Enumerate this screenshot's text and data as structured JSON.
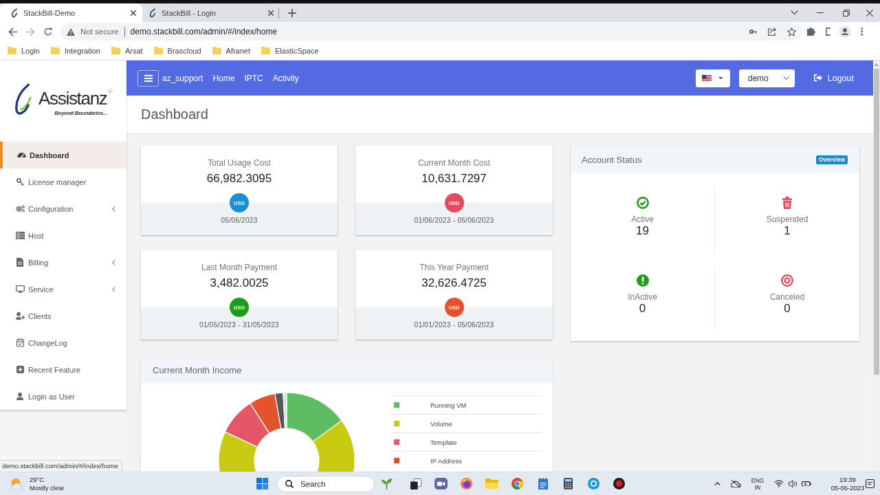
{
  "browser": {
    "tabs": [
      {
        "title": "StackBill-Demo",
        "selected": true
      },
      {
        "title": "StackBill - Login",
        "selected": false
      }
    ],
    "security_label": "Not secure",
    "url": "demo.stackbill.com/admin/#/index/home",
    "bookmarks": [
      "Login",
      "Integration",
      "Arsat",
      "Brascloud",
      "Afranet",
      "ElasticSpace"
    ]
  },
  "sidebar": {
    "logo": {
      "name": "Assistanz",
      "tagline": "Beyond Boundaries..."
    },
    "items": [
      {
        "label": "Dashboard",
        "selected": true,
        "submenu": false
      },
      {
        "label": "License manager",
        "selected": false,
        "submenu": false
      },
      {
        "label": "Configuration",
        "selected": false,
        "submenu": true
      },
      {
        "label": "Host",
        "selected": false,
        "submenu": false
      },
      {
        "label": "Billing",
        "selected": false,
        "submenu": true
      },
      {
        "label": "Service",
        "selected": false,
        "submenu": true
      },
      {
        "label": "Clients",
        "selected": false,
        "submenu": false
      },
      {
        "label": "ChangeLog",
        "selected": false,
        "submenu": false
      },
      {
        "label": "Recent Feature",
        "selected": false,
        "submenu": false
      },
      {
        "label": "Login as User",
        "selected": false,
        "submenu": false
      }
    ]
  },
  "navbar": {
    "user": "az_support",
    "links": [
      "Home",
      "IPTC",
      "Activity"
    ],
    "account": "demo",
    "logout": "Logout"
  },
  "page_title": "Dashboard",
  "stats": [
    {
      "title": "Total Usage Cost",
      "value": "66,982.3095",
      "currency": "USD",
      "color": "#1b8fd2",
      "period": "05/06/2023"
    },
    {
      "title": "Current Month Cost",
      "value": "10,631.7297",
      "currency": "USD",
      "color": "#e44a62",
      "period": "01/06/2023 - 05/06/2023"
    },
    {
      "title": "Last Month Payment",
      "value": "3,482.0025",
      "currency": "USD",
      "color": "#1a9e1a",
      "period": "01/05/2023 - 31/05/2023"
    },
    {
      "title": "This Year Payment",
      "value": "32,626.4725",
      "currency": "USD",
      "color": "#e5512a",
      "period": "01/01/2023 - 05/06/2023"
    }
  ],
  "account_status": {
    "title": "Account Status",
    "badge": "Overview",
    "items": [
      {
        "kind": "active",
        "label": "Active",
        "count": "19",
        "color": "#1e9e1e"
      },
      {
        "kind": "suspended",
        "label": "Suspended",
        "count": "1",
        "color": "#e04b5f"
      },
      {
        "kind": "inactive",
        "label": "InActive",
        "count": "0",
        "color": "#1e9e1e"
      },
      {
        "kind": "canceled",
        "label": "Canceled",
        "count": "0",
        "color": "#e04b5f"
      }
    ]
  },
  "income": {
    "title": "Current Month Income",
    "legend": [
      {
        "label": "Running VM",
        "color": "#5cbd62"
      },
      {
        "label": "Volume",
        "color": "#c8cb12"
      },
      {
        "label": "Template",
        "color": "#e55668"
      },
      {
        "label": "IP Address",
        "color": "#e4532d"
      }
    ]
  },
  "status_bubble": "demo.stackbill.com/admin/#/index/home",
  "taskbar": {
    "weather": {
      "temperature": "29°C",
      "condition": "Mostly clear"
    },
    "search_button": "Search",
    "language": "ENG",
    "region": "IN",
    "time": "19:39",
    "date": "05-06-2023"
  }
}
